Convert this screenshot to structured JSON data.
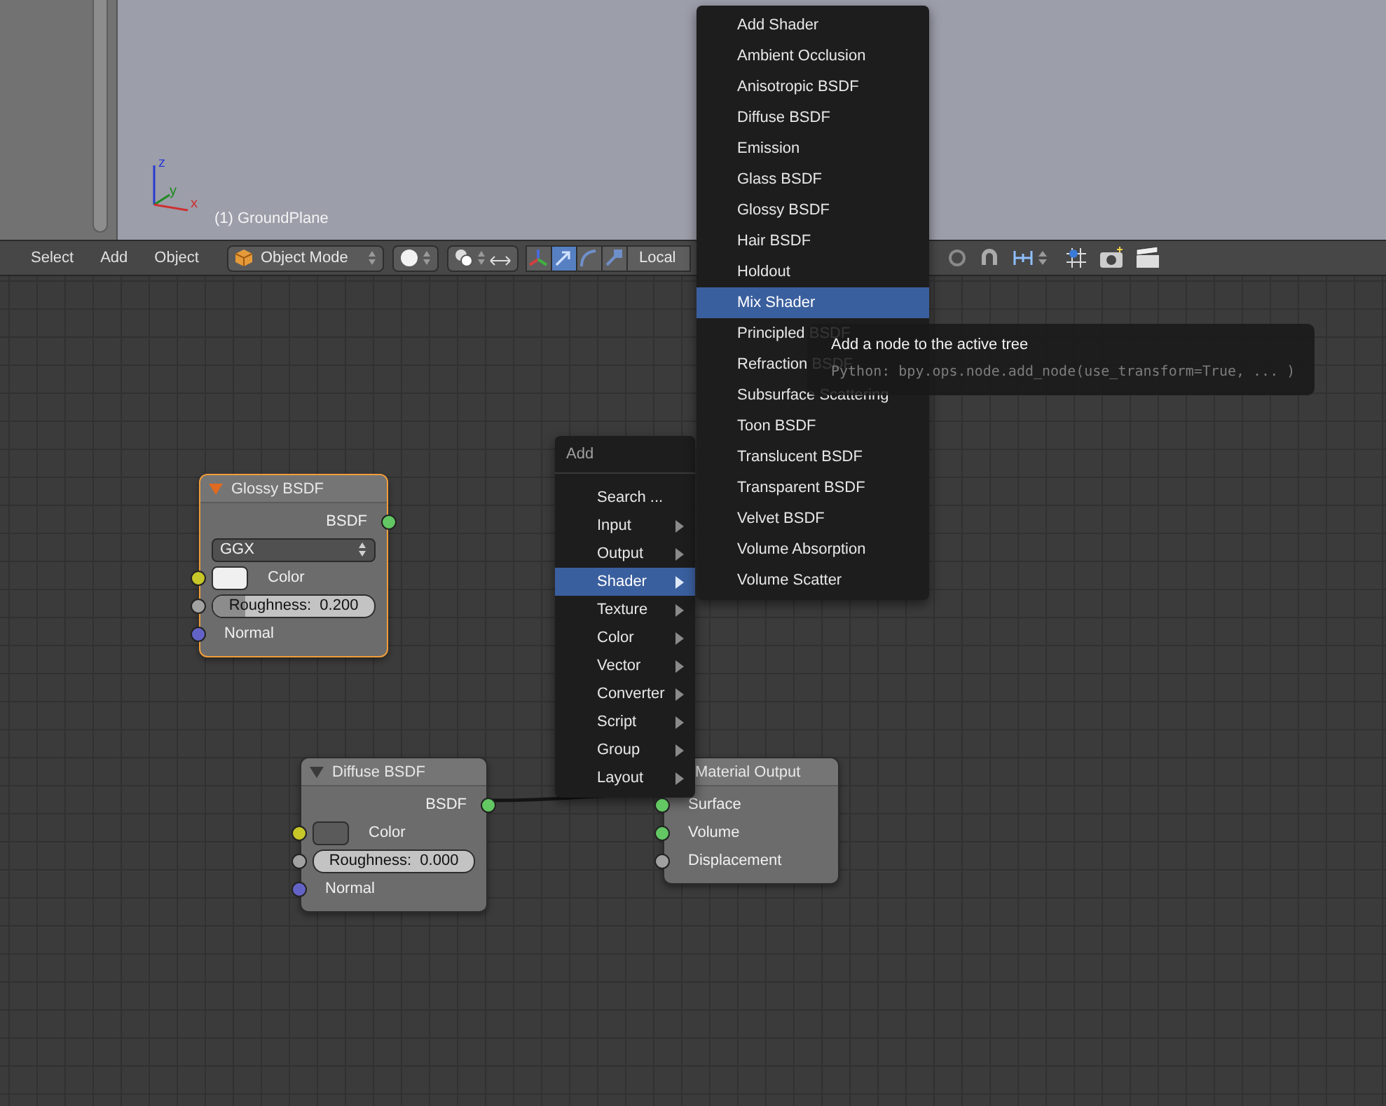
{
  "viewport": {
    "object_label": "(1) GroundPlane",
    "axes": [
      {
        "label": "z",
        "color": "#2a3ad0"
      },
      {
        "label": "y",
        "color": "#1f8a1f"
      },
      {
        "label": "x",
        "color": "#cf3030"
      }
    ]
  },
  "header": {
    "menus": [
      "Select",
      "Add",
      "Object"
    ],
    "mode": "Object Mode",
    "orientation": "Local",
    "manipulators": [
      {
        "kind": "axes",
        "selected": false
      },
      {
        "kind": "translate",
        "selected": true
      },
      {
        "kind": "rotate",
        "selected": false
      },
      {
        "kind": "scale",
        "selected": false
      }
    ]
  },
  "nodes": [
    {
      "title": "Glossy BSDF",
      "selected": true,
      "rows": [
        {
          "kind": "output",
          "label": "BSDF",
          "socket": {
            "color": "#63c763"
          }
        },
        {
          "kind": "dropdown",
          "value": "GGX"
        },
        {
          "kind": "color",
          "label": "Color",
          "color": "#f0f0f0",
          "socket": {
            "color": "#c7c729"
          }
        },
        {
          "kind": "slider",
          "label": "Roughness:",
          "value": "0.200",
          "level": 0.2,
          "socket": {
            "color": "#a1a1a1"
          }
        },
        {
          "kind": "input",
          "label": "Normal",
          "socket": {
            "color": "#6363c7"
          }
        }
      ]
    },
    {
      "title": "Diffuse BSDF",
      "selected": false,
      "rows": [
        {
          "kind": "output",
          "label": "BSDF",
          "socket": {
            "color": "#63c763"
          }
        },
        {
          "kind": "color",
          "label": "Color",
          "color": "#5a5a5a",
          "socket": {
            "color": "#c7c729"
          }
        },
        {
          "kind": "slider",
          "label": "Roughness:",
          "value": "0.000",
          "level": 0.0,
          "socket": {
            "color": "#a1a1a1"
          }
        },
        {
          "kind": "input",
          "label": "Normal",
          "socket": {
            "color": "#6363c7"
          }
        }
      ]
    },
    {
      "title": "Material Output",
      "selected": false,
      "rows": [
        {
          "kind": "input",
          "label": "Surface",
          "socket": {
            "color": "#63c763"
          }
        },
        {
          "kind": "input",
          "label": "Volume",
          "socket": {
            "color": "#63c763"
          }
        },
        {
          "kind": "input",
          "label": "Displacement",
          "socket": {
            "color": "#a1a1a1"
          }
        }
      ]
    }
  ],
  "add_menu": {
    "title": "Add",
    "items": [
      {
        "label": "Search ...",
        "submenu": false,
        "selected": false
      },
      {
        "label": "Input",
        "submenu": true,
        "selected": false
      },
      {
        "label": "Output",
        "submenu": true,
        "selected": false
      },
      {
        "label": "Shader",
        "submenu": true,
        "selected": true
      },
      {
        "label": "Texture",
        "submenu": true,
        "selected": false
      },
      {
        "label": "Color",
        "submenu": true,
        "selected": false
      },
      {
        "label": "Vector",
        "submenu": true,
        "selected": false
      },
      {
        "label": "Converter",
        "submenu": true,
        "selected": false
      },
      {
        "label": "Script",
        "submenu": true,
        "selected": false
      },
      {
        "label": "Group",
        "submenu": true,
        "selected": false
      },
      {
        "label": "Layout",
        "submenu": true,
        "selected": false
      }
    ]
  },
  "shader_menu": {
    "items": [
      {
        "label": "Add Shader",
        "selected": false
      },
      {
        "label": "Ambient Occlusion",
        "selected": false
      },
      {
        "label": "Anisotropic BSDF",
        "selected": false
      },
      {
        "label": "Diffuse BSDF",
        "selected": false
      },
      {
        "label": "Emission",
        "selected": false
      },
      {
        "label": "Glass BSDF",
        "selected": false
      },
      {
        "label": "Glossy BSDF",
        "selected": false
      },
      {
        "label": "Hair BSDF",
        "selected": false
      },
      {
        "label": "Holdout",
        "selected": false
      },
      {
        "label": "Mix Shader",
        "selected": true
      },
      {
        "label": "Principled BSDF",
        "selected": false
      },
      {
        "label": "Refraction BSDF",
        "selected": false
      },
      {
        "label": "Subsurface Scattering",
        "selected": false
      },
      {
        "label": "Toon BSDF",
        "selected": false
      },
      {
        "label": "Translucent BSDF",
        "selected": false
      },
      {
        "label": "Transparent BSDF",
        "selected": false
      },
      {
        "label": "Velvet BSDF",
        "selected": false
      },
      {
        "label": "Volume Absorption",
        "selected": false
      },
      {
        "label": "Volume Scatter",
        "selected": false
      }
    ]
  },
  "tooltip": {
    "title": "Add a node to the active tree",
    "python": "Python: bpy.ops.node.add_node(use_transform=True, ... )"
  }
}
